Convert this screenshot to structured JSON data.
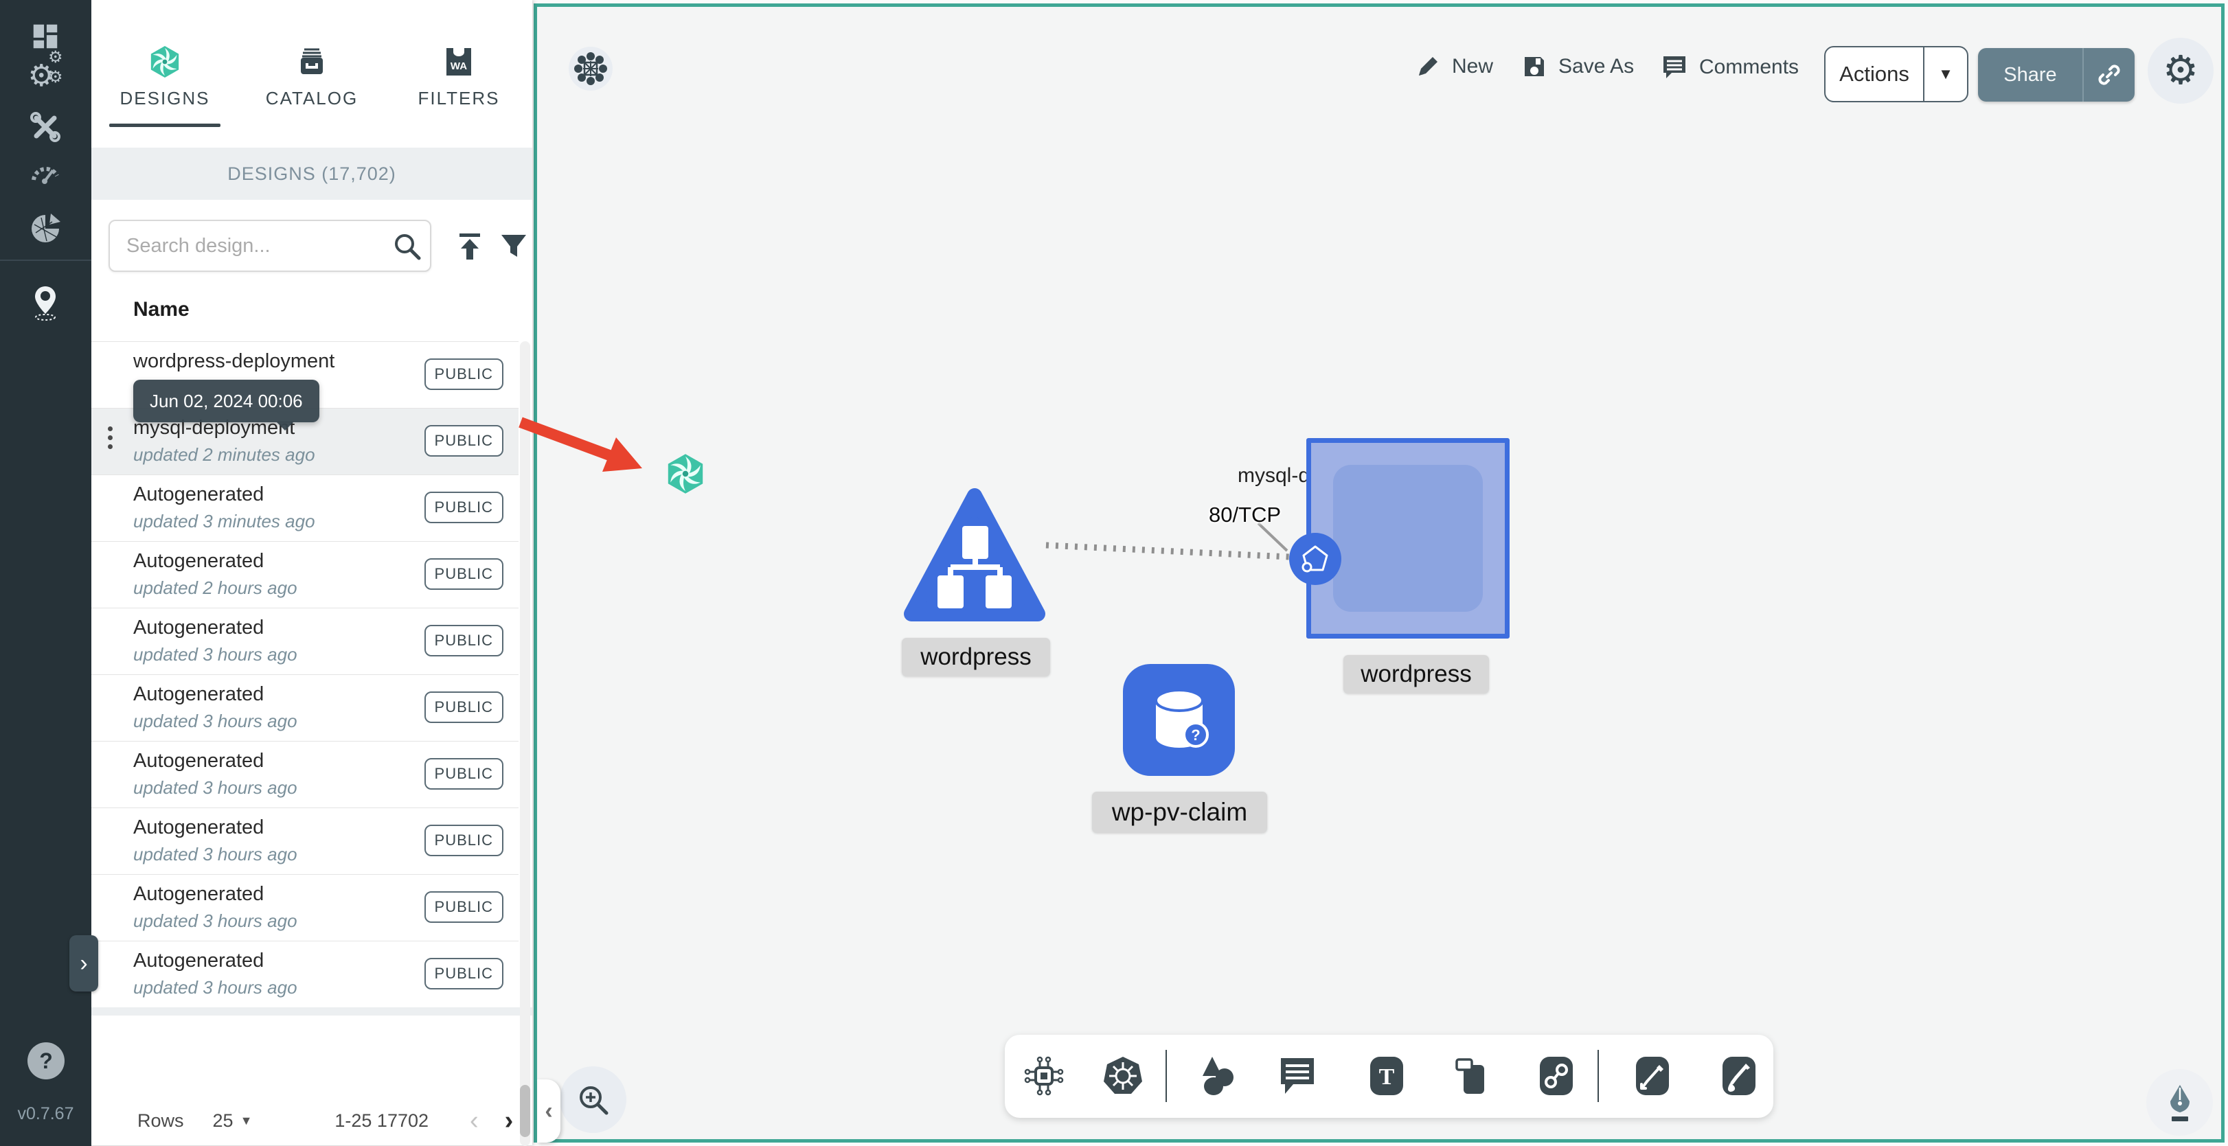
{
  "app": {
    "version": "v0.7.67"
  },
  "colors": {
    "accent_teal": "#3fa795",
    "sidebar_bg": "#263238",
    "node_blue": "#3e6edd",
    "arrow_red": "#e8432e",
    "dark_icon": "#3c494f"
  },
  "sidebar": {
    "icons": [
      "dashboard-icon",
      "lifecycle-gears-icon",
      "configuration-tools-icon",
      "performance-gauge-icon",
      "extensions-pie-icon",
      "kanvas-pin-icon"
    ],
    "help_label": "?"
  },
  "tabs": [
    {
      "label": "DESIGNS",
      "icon": "meshery-logo-icon",
      "active": true
    },
    {
      "label": "CATALOG",
      "icon": "catalog-archive-icon",
      "active": false
    },
    {
      "label": "FILTERS",
      "icon": "wasm-filter-icon",
      "active": false
    }
  ],
  "drawer": {
    "header": "DESIGNS (17,702)",
    "search_placeholder": "Search design...",
    "column_name": "Name",
    "tooltip": "Jun 02, 2024 00:06",
    "rows": [
      {
        "name": "wordpress-deployment",
        "subtitle": "",
        "badge": "PUBLIC",
        "selected": false
      },
      {
        "name": "mysql-deployment",
        "subtitle": "updated 2 minutes ago",
        "badge": "PUBLIC",
        "selected": true
      },
      {
        "name": "Autogenerated",
        "subtitle": "updated 3 minutes ago",
        "badge": "PUBLIC",
        "selected": false
      },
      {
        "name": "Autogenerated",
        "subtitle": "updated 2 hours ago",
        "badge": "PUBLIC",
        "selected": false
      },
      {
        "name": "Autogenerated",
        "subtitle": "updated 3 hours ago",
        "badge": "PUBLIC",
        "selected": false
      },
      {
        "name": "Autogenerated",
        "subtitle": "updated 3 hours ago",
        "badge": "PUBLIC",
        "selected": false
      },
      {
        "name": "Autogenerated",
        "subtitle": "updated 3 hours ago",
        "badge": "PUBLIC",
        "selected": false
      },
      {
        "name": "Autogenerated",
        "subtitle": "updated 3 hours ago",
        "badge": "PUBLIC",
        "selected": false
      },
      {
        "name": "Autogenerated",
        "subtitle": "updated 3 hours ago",
        "badge": "PUBLIC",
        "selected": false
      },
      {
        "name": "Autogenerated",
        "subtitle": "updated 3 hours ago",
        "badge": "PUBLIC",
        "selected": false
      }
    ],
    "footer": {
      "rows_label": "Rows",
      "page_size": "25",
      "range": "1-25 17702",
      "prev": "‹",
      "next": "›"
    }
  },
  "topbar": {
    "new": "New",
    "save_as": "Save As",
    "comments": "Comments",
    "actions": "Actions",
    "share": "Share"
  },
  "canvas": {
    "mysql_label": "mysql-deployment",
    "service_label": "wordpress",
    "deployment_label": "wordpress",
    "pvc_label": "wp-pv-claim",
    "edge_label": "80/TCP",
    "toolbar_icons": [
      "component-icon",
      "kubernetes-icon",
      "shapes-icon",
      "comment-tool-icon",
      "text-tool-icon",
      "card-tool-icon",
      "link-tool-icon",
      "pen-tool-icon",
      "pencil-tool-icon"
    ]
  }
}
